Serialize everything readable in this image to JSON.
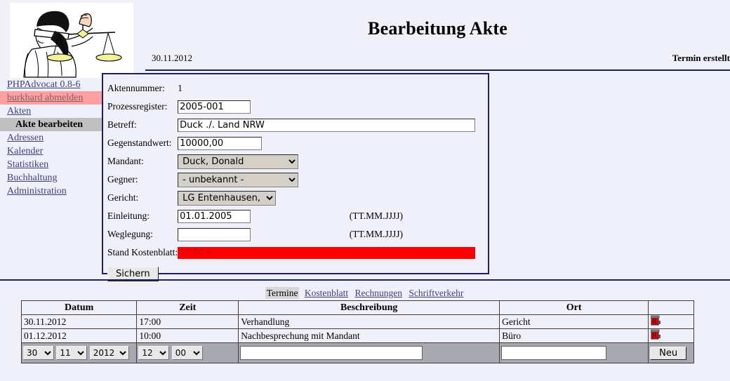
{
  "brand": {
    "name": "PHPAdvocat 0.8-6",
    "logo_icon": "justitia-scales-icon"
  },
  "sidebar": {
    "logout": {
      "label": "burkhard abmelden",
      "bg": "#ffa0a0"
    },
    "items": [
      {
        "label": "Akten",
        "type": "link"
      },
      {
        "label": "Akte bearbeiten",
        "type": "current"
      },
      {
        "label": "Adressen",
        "type": "link"
      },
      {
        "label": "Kalender",
        "type": "link"
      },
      {
        "label": "Statistiken",
        "type": "link"
      },
      {
        "label": "Buchhaltung",
        "type": "link"
      },
      {
        "label": "Administration",
        "type": "link"
      }
    ]
  },
  "header": {
    "title": "Bearbeitung Akte",
    "date": "30.11.2012",
    "status": "Termin erstellt"
  },
  "form": {
    "aktennummer": {
      "label": "Aktennummer:",
      "value": "1"
    },
    "prozessregister": {
      "label": "Prozessregister:",
      "value": "2005-001"
    },
    "betreff": {
      "label": "Betreff:",
      "value": "Duck ./. Land NRW"
    },
    "gegenstandwert": {
      "label": "Gegenstandwert:",
      "value": "10000,00"
    },
    "mandant": {
      "label": "Mandant:",
      "value": "Duck, Donald"
    },
    "gegner": {
      "label": "Gegner:",
      "value": "- unbekannt -"
    },
    "gericht": {
      "label": "Gericht:",
      "value": "LG Entenhausen,"
    },
    "einleitung": {
      "label": "Einleitung:",
      "value": "01.01.2005",
      "hint": "(TT.MM.JJJJ)"
    },
    "weglegung": {
      "label": "Weglegung:",
      "value": "",
      "hint": "(TT.MM.JJJJ)"
    },
    "kostenblatt": {
      "label": "Stand Kostenblatt:",
      "value": "20,00 €",
      "bar_color": "#ff0000",
      "text_color": "#cc0000"
    },
    "save_button": "Sichern"
  },
  "tabs": [
    {
      "label": "Termine",
      "active": true
    },
    {
      "label": "Kostenblatt",
      "active": false
    },
    {
      "label": "Rechnungen",
      "active": false
    },
    {
      "label": "Schriftverkehr",
      "active": false
    }
  ],
  "termine": {
    "columns": [
      "Datum",
      "Zeit",
      "Beschreibung",
      "Ort",
      ""
    ],
    "rows": [
      {
        "datum": "30.11.2012",
        "zeit": "17:00",
        "beschreibung": "Verhandlung",
        "ort": "Gericht",
        "action_icon": "trash-icon"
      },
      {
        "datum": "01.12.2012",
        "zeit": "10:00",
        "beschreibung": "Nachbesprechung mit Mandant",
        "ort": "Büro",
        "action_icon": "trash-icon"
      }
    ],
    "new_row": {
      "day": "30",
      "month": "11",
      "year": "2012",
      "hour": "12",
      "minute": "00",
      "beschreibung": "",
      "ort": "",
      "add_button": "Neu"
    }
  }
}
